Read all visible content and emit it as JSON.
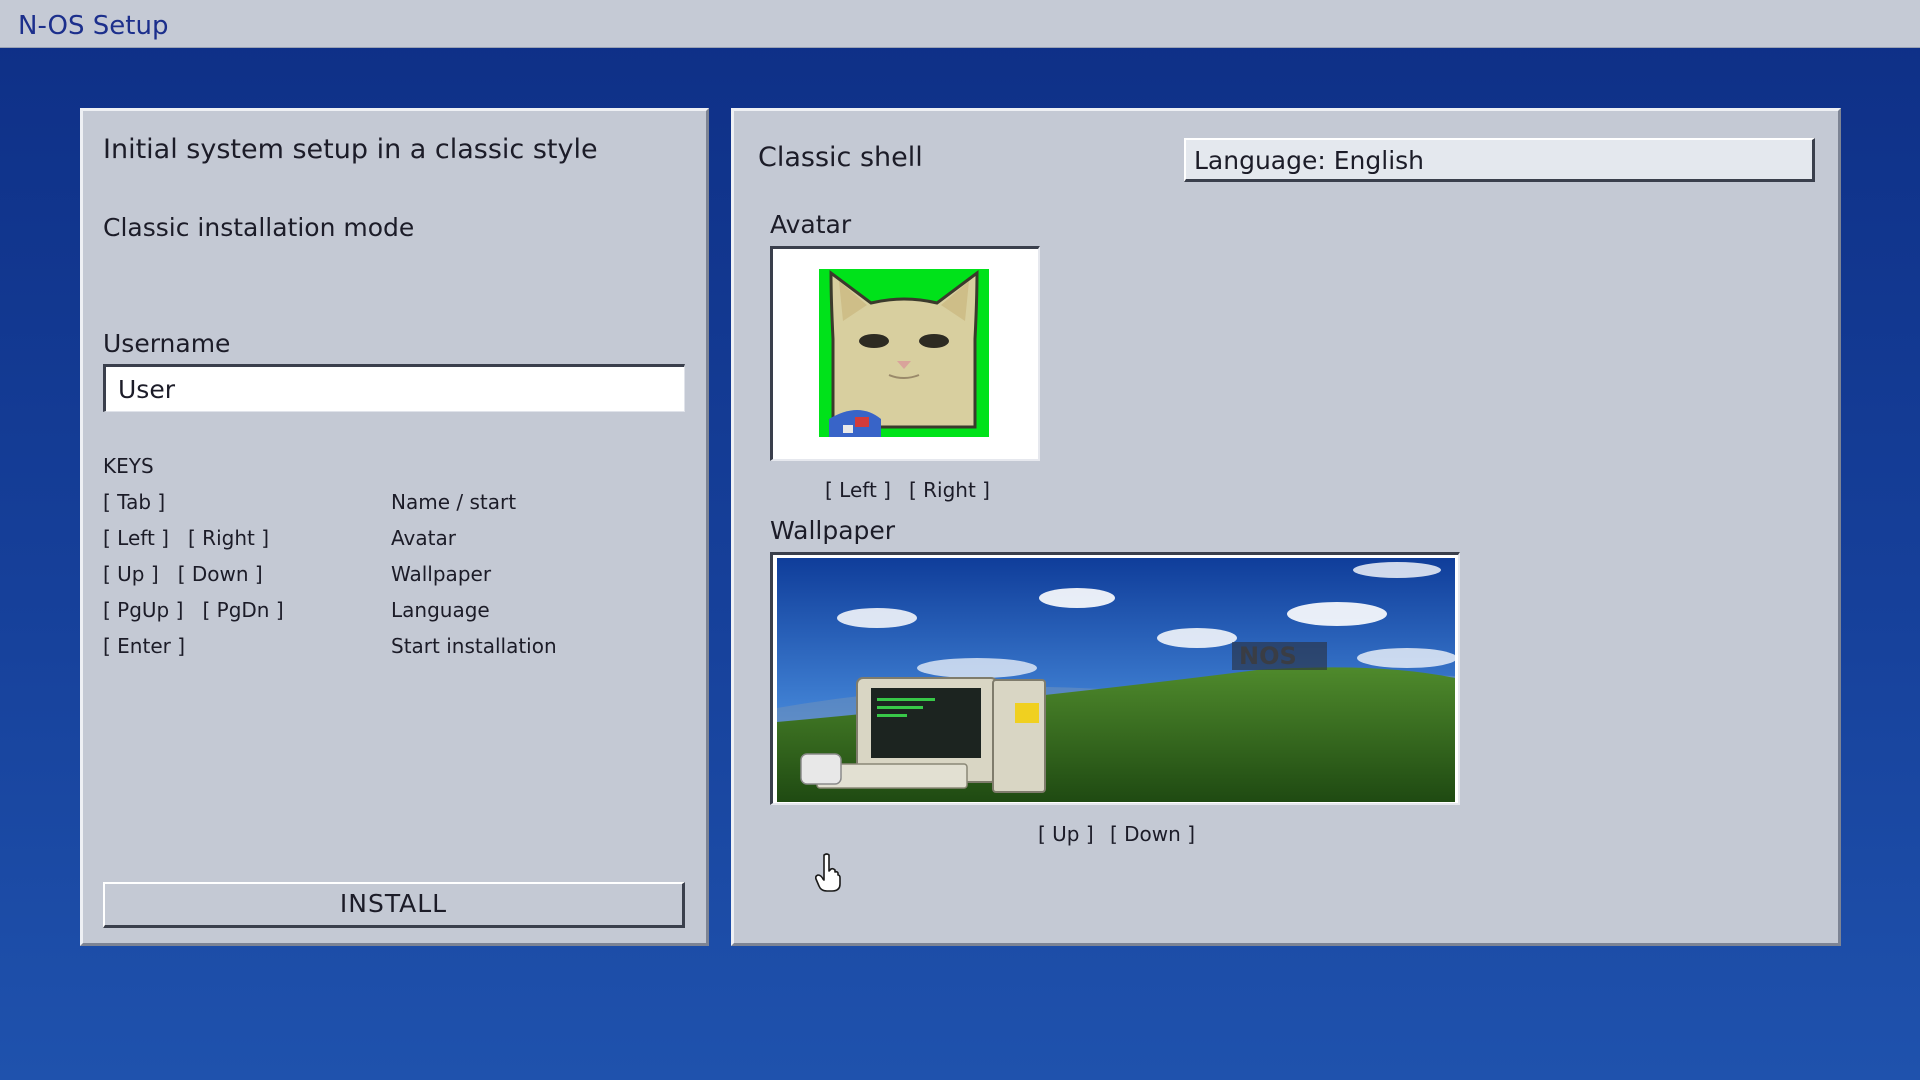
{
  "window": {
    "title": "N-OS Setup"
  },
  "left": {
    "heading": "Initial system setup in a classic style",
    "mode": "Classic installation mode",
    "username_label": "Username",
    "username_value": "User",
    "keys_title": "KEYS",
    "keys": [
      {
        "key": "[ Tab ]",
        "action": "Name / start"
      },
      {
        "key": "[ Left ]   [ Right ]",
        "action": "Avatar"
      },
      {
        "key": "[ Up ]   [ Down ]",
        "action": "Wallpaper"
      },
      {
        "key": "[ PgUp ]   [ PgDn ]",
        "action": "Language"
      },
      {
        "key": "[ Enter ]",
        "action": "Start installation"
      }
    ],
    "install_button": "INSTALL"
  },
  "right": {
    "shell_title": "Classic shell",
    "language_select": "Language: English",
    "avatar_label": "Avatar",
    "avatar_left": "[ Left ]",
    "avatar_right": "[ Right ]",
    "wallpaper_label": "Wallpaper",
    "wallpaper_up": "[ Up ]",
    "wallpaper_down": "[ Down ]",
    "wallpaper_brand": "NOS"
  },
  "colors": {
    "background": "#16409a",
    "panel": "#c4c9d4",
    "title_text": "#1c2f8c",
    "avatar_bg": "#00e21a"
  },
  "icons": {
    "avatar": "cat-avatar-icon",
    "pointer": "hand-pointer-icon"
  }
}
